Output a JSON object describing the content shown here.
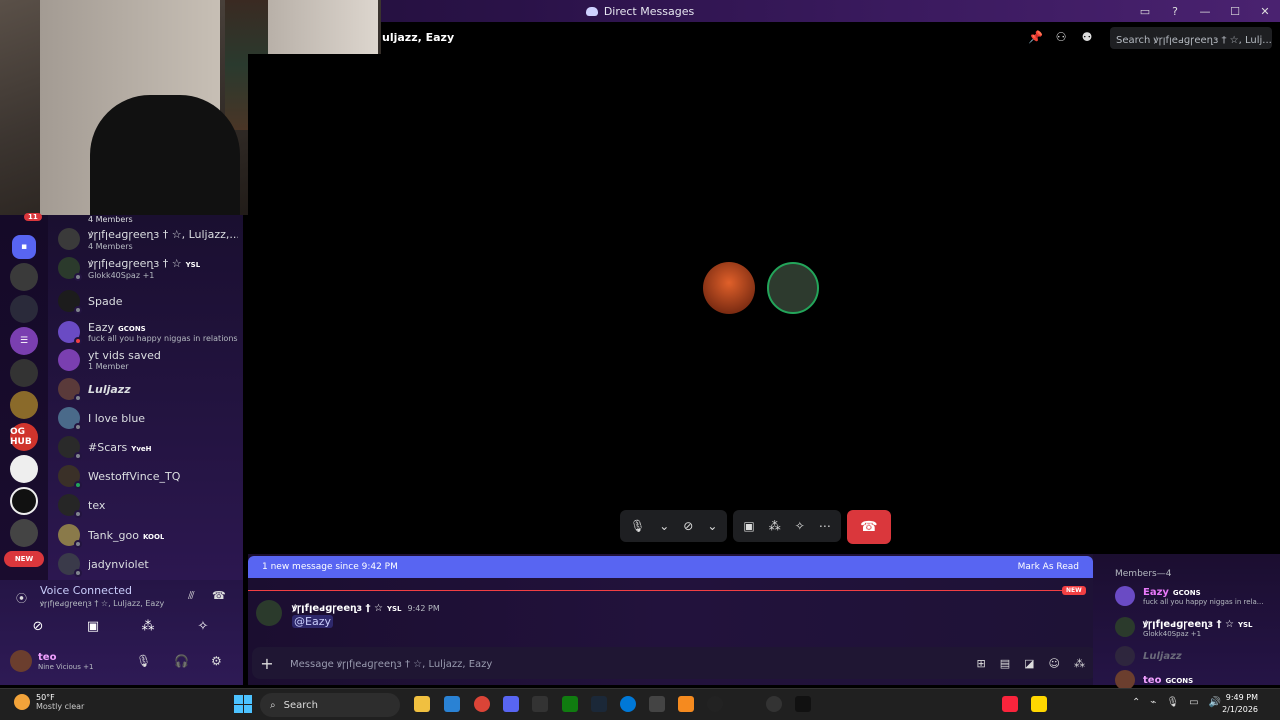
{
  "window": {
    "title": "Direct Messages",
    "controls": [
      "—",
      "☐",
      "✕"
    ]
  },
  "header": {
    "channel_name": "uljazz, Eazy",
    "search_placeholder": "Search ꝟꞅꞁfꞁeԁɡꞅeeղɜ † ☆, Lulj..."
  },
  "dm_list": {
    "top_partial": "4 Members",
    "badge_count": "11",
    "items": [
      {
        "name": "ꝟꞅꞁfꞁeԁɡꞅeeղɜ † ☆, Luljazz,...",
        "sub": "4 Members",
        "avatar_color": "#3a3a3a"
      },
      {
        "name": "ꝟꞅꞁfꞁeԁɡꞅeeղɜ † ☆",
        "tag": "YSL",
        "sub": "Glokk40Spaz +1",
        "avatar_color": "#2b3a2c"
      },
      {
        "name": "Spade",
        "sub": "",
        "avatar_color": "#1c1c1c"
      },
      {
        "name": "Eazy",
        "tag": "GCONS",
        "sub": "fuck all you happy niggas in relations...",
        "avatar_color": "#6a4bc4"
      },
      {
        "name": "yt vids saved",
        "sub": "1 Member",
        "avatar_color": "#7a3fb0"
      },
      {
        "name": "Luljazz",
        "sub": "",
        "avatar_color": "#5a3a3a"
      },
      {
        "name": "I love blue",
        "sub": "",
        "avatar_color": "#4a6a8a"
      },
      {
        "name": "#Scars",
        "tag": "YveH",
        "sub": "",
        "avatar_color": "#2a2a2a"
      },
      {
        "name": "WestoffVince_TQ",
        "sub": "",
        "avatar_color": "#3a3028"
      },
      {
        "name": "tex",
        "sub": "",
        "avatar_color": "#262626"
      },
      {
        "name": "Tank_goo",
        "tag": "KOOL",
        "sub": "",
        "avatar_color": "#8a7a4a"
      },
      {
        "name": "jadynviolet",
        "sub": "",
        "avatar_color": "#3a3a4a"
      }
    ]
  },
  "servers": {
    "new_label": "NEW",
    "og_hub": "OG HUB"
  },
  "voice": {
    "status": "Voice Connected",
    "channel": "ꝟꞅꞁfꞁeԁɡꞅeeղɜ † ☆, Luljazz, Eazy"
  },
  "user": {
    "name": "teo",
    "status": "Nine Vicious +1"
  },
  "call": {
    "avatars": [
      {
        "color": "#c0451e"
      },
      {
        "color": "#2d3a2e"
      }
    ]
  },
  "chat": {
    "new_messages": "1 new message since 9:42 PM",
    "mark_read": "Mark As Read",
    "new_pill": "NEW",
    "message": {
      "author": "ꝟꞅꞁfꞁeԁɡꞅeeղɜ † ☆",
      "tag": "YSL",
      "time": "9:42 PM",
      "content": "@Eazy"
    },
    "composer_placeholder": "Message ꝟꞅꞁfꞁeԁɡꞅeeղɜ † ☆, Luljazz, Eazy"
  },
  "members": {
    "header": "Members—4",
    "list": [
      {
        "name": "Eazy",
        "tag": "GCONS",
        "sub": "fuck all you happy niggas in rela...",
        "color": "#e879f9"
      },
      {
        "name": "ꝟꞅꞁfꞁeԁɡꞅeeղɜ † ☆",
        "tag": "YSL",
        "sub": "Glokk40Spaz +1",
        "color": "#ffffff"
      },
      {
        "name": "Luljazz",
        "tag": "",
        "sub": "",
        "color": "#6b6b7b"
      },
      {
        "name": "teo",
        "tag": "GCONS",
        "sub": "",
        "color": "#f0a0ff"
      }
    ]
  },
  "taskbar": {
    "weather_temp": "50°F",
    "weather_desc": "Mostly clear",
    "search_label": "Search",
    "time": "9:49 PM",
    "date": "2/1/2026"
  }
}
